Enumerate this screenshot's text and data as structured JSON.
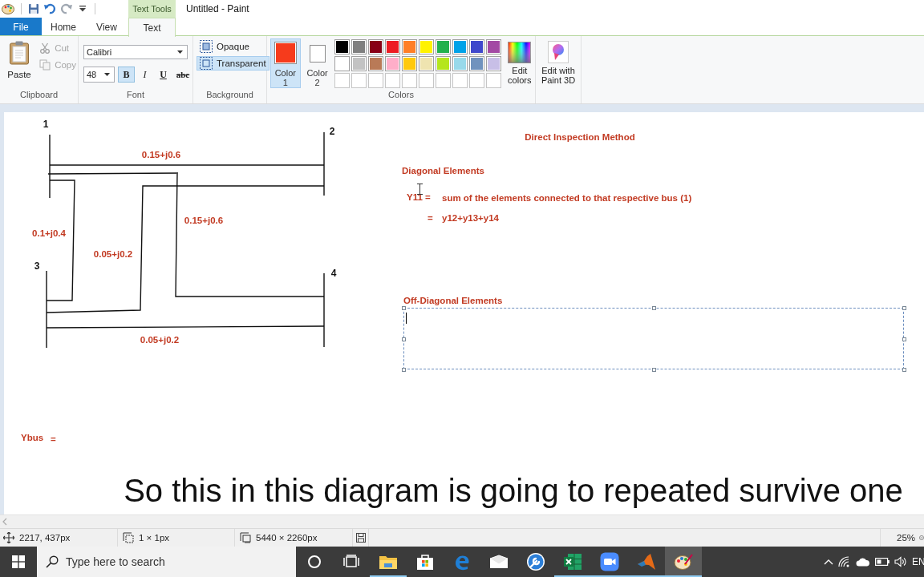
{
  "title_bar": {
    "contextual_tab": "Text Tools",
    "title": "Untitled - Paint"
  },
  "tabs": [
    {
      "label": "File",
      "kind": "file",
      "selected": false
    },
    {
      "label": "Home",
      "kind": "tab",
      "selected": false
    },
    {
      "label": "View",
      "kind": "tab",
      "selected": false
    },
    {
      "label": "Text",
      "kind": "tab",
      "selected": true
    }
  ],
  "ribbon": {
    "clipboard": {
      "label": "Clipboard",
      "paste": "Paste",
      "actions": [
        {
          "kind": "cut",
          "label": "Cut",
          "disabled": true
        },
        {
          "kind": "copy",
          "label": "Copy",
          "disabled": true
        }
      ]
    },
    "font": {
      "label": "Font",
      "family": "Calibri",
      "size": "48",
      "styles": [
        {
          "kind": "bold",
          "label": "B",
          "selected": true
        },
        {
          "kind": "italic",
          "label": "I",
          "selected": false
        },
        {
          "kind": "underline",
          "label": "U",
          "selected": false
        },
        {
          "kind": "strike",
          "label": "abc",
          "selected": false
        }
      ]
    },
    "background": {
      "label": "Background",
      "options": [
        {
          "label": "Opaque",
          "selected": false
        },
        {
          "label": "Transparent",
          "selected": true
        }
      ]
    },
    "colors": {
      "label": "Colors",
      "slots": [
        {
          "label": "Color 1",
          "color": "#f63b1c",
          "selected": true
        },
        {
          "label": "Color 2",
          "color": "#ffffff",
          "selected": false
        }
      ],
      "palette": [
        {
          "kind": "color",
          "color": "#000000"
        },
        {
          "kind": "color",
          "color": "#7f7f7f"
        },
        {
          "kind": "color",
          "color": "#880015"
        },
        {
          "kind": "color",
          "color": "#ed1c24"
        },
        {
          "kind": "color",
          "color": "#ff7f27"
        },
        {
          "kind": "color",
          "color": "#fff200"
        },
        {
          "kind": "color",
          "color": "#22b14c"
        },
        {
          "kind": "color",
          "color": "#00a2e8"
        },
        {
          "kind": "color",
          "color": "#3f48cc"
        },
        {
          "kind": "color",
          "color": "#a349a4"
        },
        {
          "kind": "color",
          "color": "#ffffff"
        },
        {
          "kind": "color",
          "color": "#c3c3c3"
        },
        {
          "kind": "color",
          "color": "#b97a57"
        },
        {
          "kind": "color",
          "color": "#ffaec9"
        },
        {
          "kind": "color",
          "color": "#ffc90e"
        },
        {
          "kind": "color",
          "color": "#efe4b0"
        },
        {
          "kind": "color",
          "color": "#b5e61d"
        },
        {
          "kind": "color",
          "color": "#99d9ea"
        },
        {
          "kind": "color",
          "color": "#7092be"
        },
        {
          "kind": "color",
          "color": "#c8bfe7"
        },
        {
          "kind": "empty"
        },
        {
          "kind": "empty"
        },
        {
          "kind": "empty"
        },
        {
          "kind": "empty"
        },
        {
          "kind": "empty"
        },
        {
          "kind": "empty"
        },
        {
          "kind": "empty"
        },
        {
          "kind": "empty"
        },
        {
          "kind": "empty"
        },
        {
          "kind": "empty"
        }
      ],
      "edit_colors": "Edit colors"
    },
    "paint3d": {
      "label": "Edit with Paint 3D"
    }
  },
  "canvas": {
    "diagram": {
      "buses": [
        "1",
        "2",
        "3",
        "4"
      ],
      "impedances": [
        "0.15+j0.6",
        "0.15+j0.6",
        "0.1+j0.4",
        "0.05+j0.2",
        "0.05+j0.2"
      ]
    },
    "notes": [
      "Direct Inspection Method",
      "Diagonal Elements",
      "Y11 =",
      "sum of the elements connected to that respective bus (1)",
      "=",
      "y12+y13+y14",
      "Off-Diagonal Elements",
      "Ybus",
      "="
    ],
    "caption": "So this in this diagram is going to repeated survive one"
  },
  "status_bar": {
    "cursor_position": "2217, 437px",
    "selection_size": "1 × 1px",
    "image_size": "5440 × 2260px",
    "zoom": "25%"
  },
  "taskbar": {
    "search": {
      "placeholder": "Type here to search"
    },
    "apps": [
      {
        "kind": "cortana",
        "running": false,
        "selected": false
      },
      {
        "kind": "task_view",
        "running": false,
        "selected": false
      },
      {
        "kind": "explorer",
        "running": true,
        "selected": false
      },
      {
        "kind": "store",
        "running": false,
        "selected": false
      },
      {
        "kind": "edge",
        "running": false,
        "selected": false
      },
      {
        "kind": "mail",
        "running": false,
        "selected": false
      },
      {
        "kind": "wrench",
        "running": false,
        "selected": false
      },
      {
        "kind": "excel",
        "running": true,
        "selected": false
      },
      {
        "kind": "zoom",
        "running": true,
        "selected": false
      },
      {
        "kind": "matlab",
        "running": true,
        "selected": false
      },
      {
        "kind": "paint",
        "running": true,
        "selected": true
      }
    ],
    "language": "EN"
  }
}
